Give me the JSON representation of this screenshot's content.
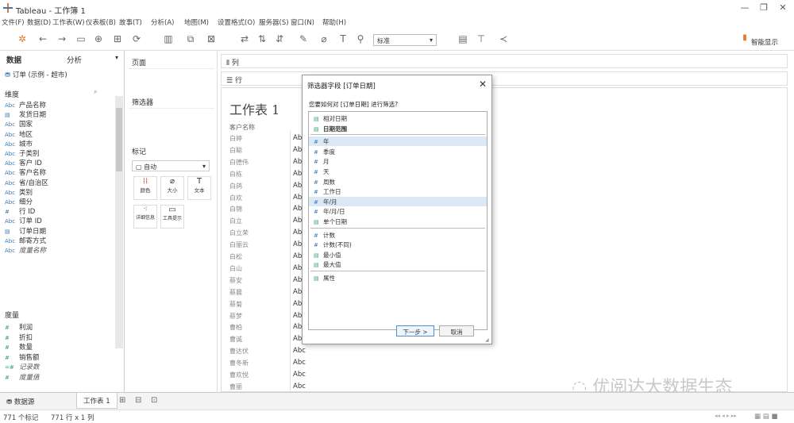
{
  "window": {
    "title": "Tableau - 工作簿 1"
  },
  "menu": [
    "文件(F)",
    "数据(D)",
    "工作表(W)",
    "仪表板(B)",
    "故事(T)",
    "分析(A)",
    "地图(M)",
    "设置格式(O)",
    "服务器(S)",
    "窗口(N)",
    "帮助(H)"
  ],
  "toolbar": {
    "fit_select": "标准",
    "show_me": "智能显示"
  },
  "datapane": {
    "tab_data": "数据",
    "tab_analysis": "分析",
    "datasource": "订单 (示例 - 超市)",
    "dimensions_header": "维度",
    "dimensions": [
      {
        "icon": "Abc",
        "label": "产品名称"
      },
      {
        "icon": "cal",
        "label": "发货日期"
      },
      {
        "icon": "Abc",
        "label": "国家"
      },
      {
        "icon": "Abc",
        "label": "地区"
      },
      {
        "icon": "Abc",
        "label": "城市"
      },
      {
        "icon": "Abc",
        "label": "子类别"
      },
      {
        "icon": "Abc",
        "label": "客户 ID"
      },
      {
        "icon": "Abc",
        "label": "客户名称"
      },
      {
        "icon": "Abc",
        "label": "省/自治区"
      },
      {
        "icon": "Abc",
        "label": "类别"
      },
      {
        "icon": "Abc",
        "label": "细分"
      },
      {
        "icon": "#",
        "label": "行 ID"
      },
      {
        "icon": "Abc",
        "label": "订单 ID"
      },
      {
        "icon": "cal",
        "label": "订单日期"
      },
      {
        "icon": "Abc",
        "label": "邮寄方式"
      },
      {
        "icon": "Abc",
        "label": "度量名称",
        "italic": true
      }
    ],
    "measures_header": "度量",
    "measures": [
      {
        "icon": "#",
        "label": "利润"
      },
      {
        "icon": "#",
        "label": "折扣"
      },
      {
        "icon": "#",
        "label": "数量"
      },
      {
        "icon": "#",
        "label": "销售额"
      },
      {
        "icon": "=#",
        "label": "记录数",
        "italic": true
      },
      {
        "icon": "#",
        "label": "度量值",
        "italic": true
      }
    ]
  },
  "cards": {
    "pages": "页面",
    "filters": "筛选器",
    "marks": "标记",
    "marks_type": "自动",
    "mark_buttons": [
      "颜色",
      "大小",
      "文本",
      "详细信息",
      "工具提示"
    ]
  },
  "shelves": {
    "columns": "列",
    "rows": "行"
  },
  "sheet": {
    "title": "工作表 1",
    "column_header": "客户名称",
    "rows": [
      "白婷",
      "白聪",
      "白德伟",
      "白栋",
      "白鸽",
      "白欢",
      "白锦",
      "白立",
      "白立荣",
      "白丽云",
      "白松",
      "白山",
      "蔡安",
      "蔡晨",
      "蔡菊",
      "蔡梦",
      "曹柏",
      "曹诚",
      "曹达伏",
      "曹冬新",
      "曹欢悦",
      "曹丽"
    ],
    "cell_value": "Abc"
  },
  "dialog": {
    "title": "筛选器字段 [订单日期]",
    "question": "您要如何对 [订单日期] 进行筛选?",
    "groups": [
      [
        {
          "icon": "cal",
          "label": "相对日期"
        },
        {
          "icon": "cal",
          "label": "日期范围",
          "bold": true
        }
      ],
      [
        {
          "icon": "#",
          "label": "年",
          "selected": true
        },
        {
          "icon": "#",
          "label": "季度"
        },
        {
          "icon": "#",
          "label": "月"
        },
        {
          "icon": "#",
          "label": "天"
        },
        {
          "icon": "#",
          "label": "周数"
        },
        {
          "icon": "#",
          "label": "工作日"
        },
        {
          "icon": "#",
          "label": "年/月",
          "selected": true
        },
        {
          "icon": "#",
          "label": "年/月/日"
        },
        {
          "icon": "cal",
          "label": "单个日期"
        }
      ],
      [
        {
          "icon": "#",
          "label": "计数"
        },
        {
          "icon": "#",
          "label": "计数(不同)"
        },
        {
          "icon": "cal",
          "label": "最小值"
        },
        {
          "icon": "cal",
          "label": "最大值"
        }
      ],
      [
        {
          "icon": "cal",
          "label": "属性"
        }
      ]
    ],
    "next_button": "下一步 >",
    "cancel_button": "取消"
  },
  "bottom": {
    "datasource_tab": "数据源",
    "sheet_tab": "工作表 1"
  },
  "status": {
    "marks": "771 个标记",
    "rows_cols": "771 行 x 1 列"
  },
  "watermark": "优阅达大数据生态",
  "colors": {
    "accent": "#3a7ab8",
    "green": "#2ca07a",
    "selection": "#dbe9f7"
  }
}
